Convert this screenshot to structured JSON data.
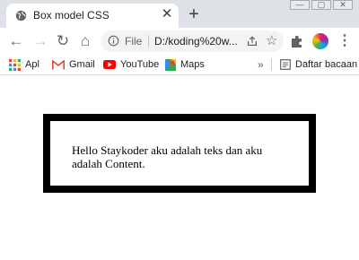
{
  "tab": {
    "title": "Box model CSS",
    "favicon": "globe-icon",
    "close_label": "✕",
    "new_tab_label": "+"
  },
  "window": {
    "minimize": "—",
    "maximize": "▢",
    "close": "✕"
  },
  "toolbar": {
    "back": "←",
    "forward": "→",
    "reload": "↻",
    "home": "⌂",
    "scheme": "File",
    "url": "D:/koding%20w...",
    "star": "☆",
    "menu": "⋮"
  },
  "bookmarks": {
    "apps": "Apl",
    "gmail": "Gmail",
    "youtube": "YouTube",
    "maps": "Maps",
    "more": "»",
    "reading_list": "Daftar bacaan"
  },
  "page": {
    "content_text": "Hello Staykoder aku adalah teks dan aku adalah Content."
  },
  "colors": {
    "tab_strip": "#dee1e6",
    "border": "#000000",
    "youtube": "#ff0000",
    "gmail": "#ea4335"
  }
}
